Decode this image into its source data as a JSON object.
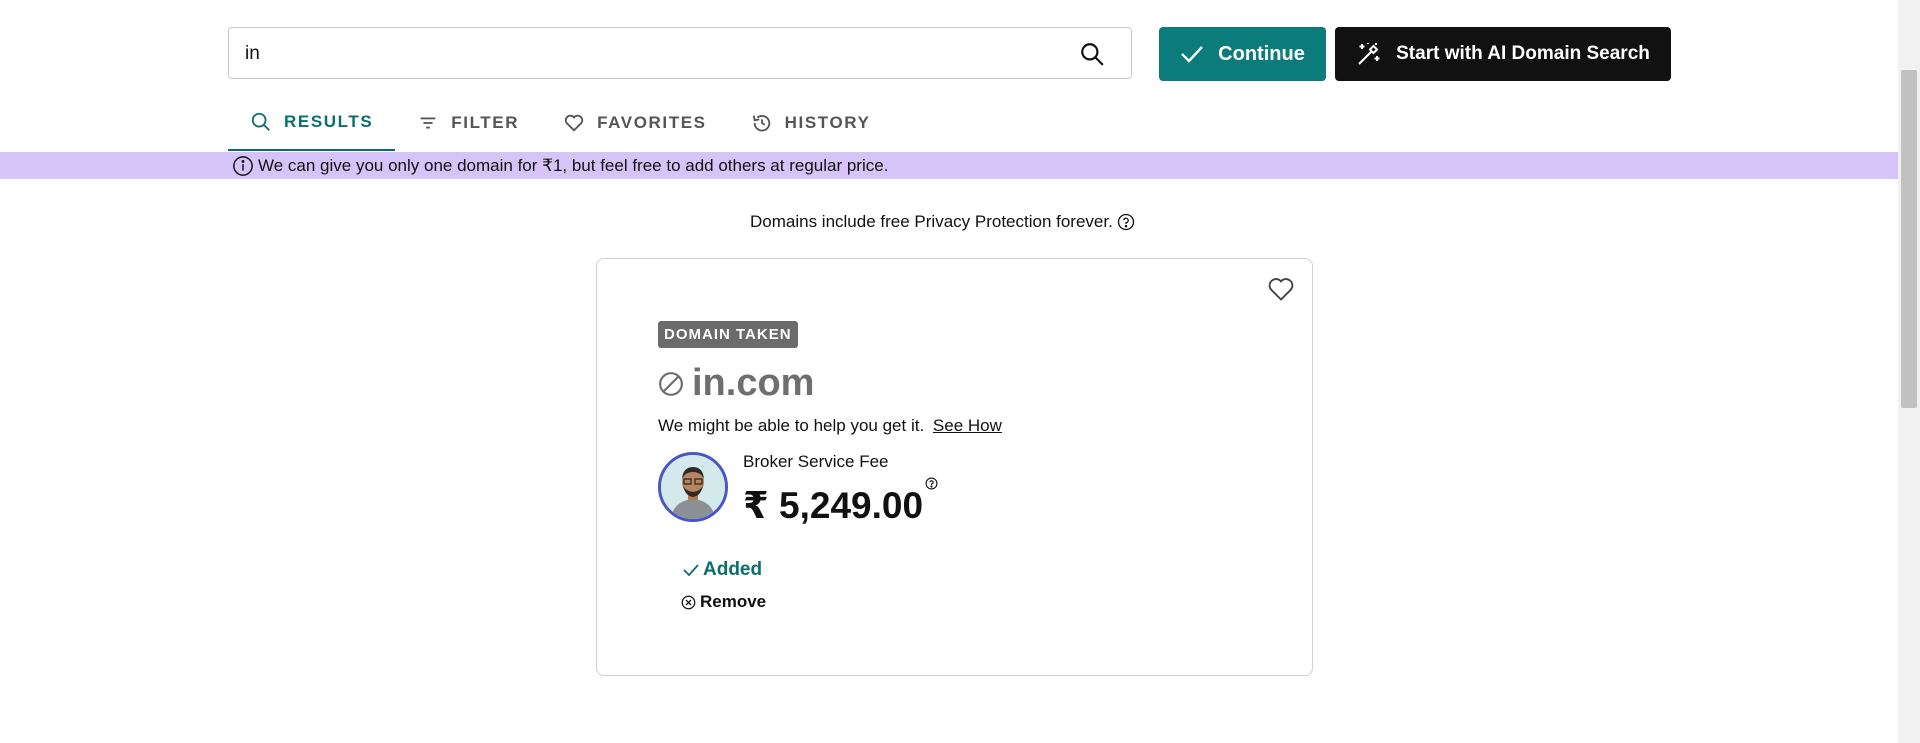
{
  "search": {
    "value": "in",
    "placeholder": ""
  },
  "buttons": {
    "continue_label": "Continue",
    "ai_label": "Start with AI Domain Search"
  },
  "tabs": [
    {
      "label": "RESULTS",
      "icon": "search-icon",
      "active": true
    },
    {
      "label": "FILTER",
      "icon": "filter-icon",
      "active": false
    },
    {
      "label": "FAVORITES",
      "icon": "heart-icon",
      "active": false
    },
    {
      "label": "HISTORY",
      "icon": "history-icon",
      "active": false
    }
  ],
  "banner": {
    "text": "We can give you only one domain for ₹1, but feel free to add others at regular price."
  },
  "privacy": {
    "text": "Domains include free Privacy Protection forever."
  },
  "card": {
    "badge": "DOMAIN TAKEN",
    "domain": "in.com",
    "help_text": "We might be able to help you get it.",
    "see_how": "See How",
    "fee_label": "Broker Service Fee",
    "price": "₹ 5,249.00",
    "added_label": "Added",
    "remove_label": "Remove"
  },
  "colors": {
    "teal": "#0b7b7b",
    "banner": "#d6c3f7",
    "badge": "#6b6b6b"
  }
}
